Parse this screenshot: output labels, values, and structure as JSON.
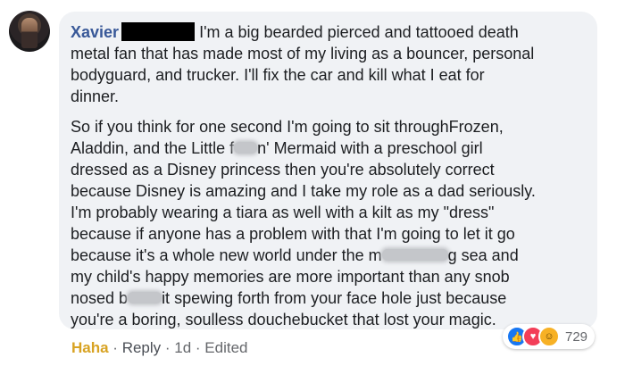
{
  "comment": {
    "author": "Xavier",
    "line1_text": "I'm a big bearded pierced and tattooed death",
    "para1_rest": [
      "metal fan that has made most of my living as a bouncer, personal",
      "bodyguard, and trucker. I'll fix the car and kill what I eat for",
      "dinner."
    ],
    "para2": {
      "l1": "So if you think for one second I'm going to sit throughFrozen,",
      "l2_a": "Aladdin, and the Little f",
      "l2_b": "n' Mermaid with a preschool girl",
      "l3": "dressed as a Disney princess then you're absolutely correct",
      "l4": "because Disney is amazing and I take my role as a dad seriously.",
      "l5": "I'm probably wearing a tiara as well with a kilt as my \"dress\"",
      "l6": "because if anyone has a problem with that I'm going to let it go",
      "l7_a": "because it's a whole new world under the m",
      "l7_b": "g sea and",
      "l8": "my child's happy memories are more important than any snob",
      "l9_a": "nosed b",
      "l9_b": "it spewing forth from your face hole just because",
      "l10": "you're a boring, soulless douchebucket that lost your magic."
    }
  },
  "footer": {
    "reaction_label": "Haha",
    "sep1": " · ",
    "reply_label": "Reply",
    "sep2": " · ",
    "time": "1d",
    "sep3": " · ",
    "edited": "Edited"
  },
  "reactions": {
    "icons": [
      "like-icon",
      "love-icon",
      "haha-icon"
    ],
    "count": "729",
    "colors": {
      "like": "#1877f2",
      "love": "#f33e58",
      "haha": "#f7b125"
    }
  }
}
